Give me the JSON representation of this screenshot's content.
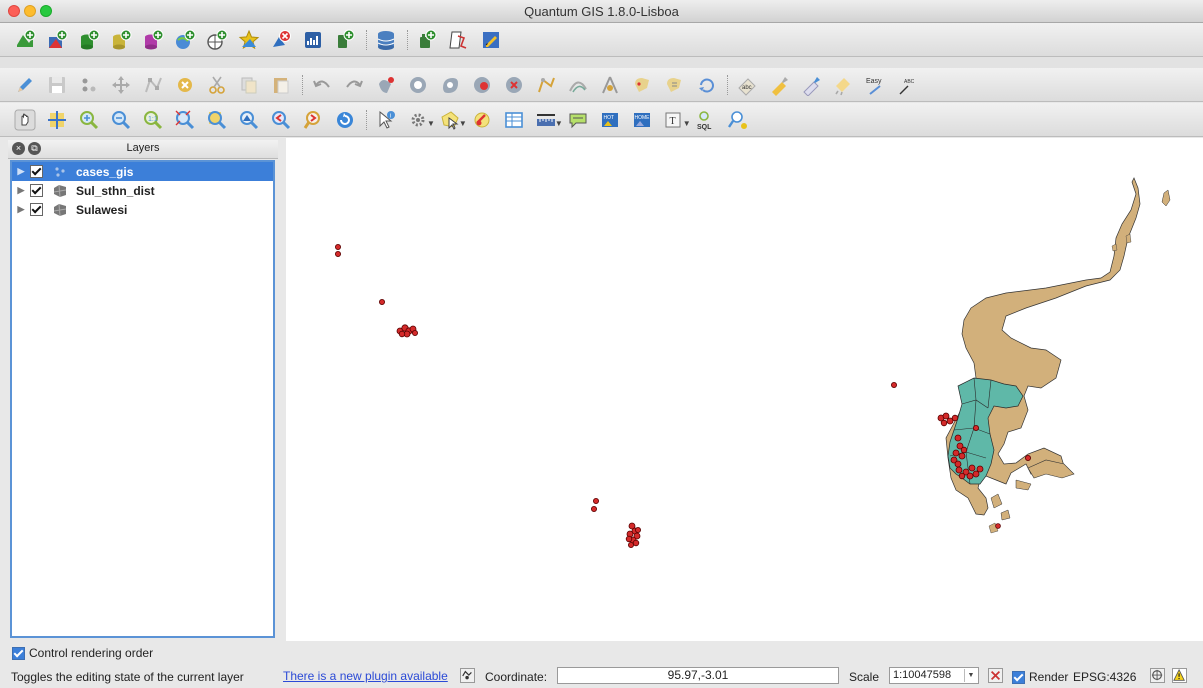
{
  "window": {
    "title": "Quantum GIS 1.8.0-Lisboa"
  },
  "toolbars": {
    "file_layers": [
      "add-vector-layer-icon",
      "add-raster-layer-icon",
      "add-postgis-layer-icon",
      "add-spatialite-layer-icon",
      "add-mssql-layer-icon",
      "add-wms-layer-icon",
      "add-wfs-layer-icon",
      "add-delimited-text-layer-icon",
      "new-shapefile-layer-icon",
      "new-spatialite-layer-icon",
      "add-gps-layer-icon",
      "db-manager-icon",
      "plugin-manager-icon",
      "python-console-icon",
      "table-manager-icon"
    ],
    "editing": [
      "toggle-editing-icon",
      "save-edits-icon",
      "add-feature-icon",
      "move-feature-icon",
      "node-tool-icon",
      "delete-selected-icon",
      "cut-features-icon",
      "copy-features-icon",
      "paste-features-icon",
      "undo-icon",
      "redo-icon",
      "simplify-feature-icon",
      "add-ring-icon",
      "add-part-icon",
      "delete-ring-icon",
      "delete-part-icon",
      "reshape-features-icon",
      "offset-curve-icon",
      "split-features-icon",
      "merge-selected-icon",
      "merge-attributes-icon",
      "rotate-point-symbols-icon",
      "label-settings-icon",
      "pin-labels-icon",
      "show-hide-labels-icon",
      "move-label-icon",
      "change-label-icon",
      "rotate-label-icon"
    ],
    "navigation": [
      "pan-map-icon",
      "pan-to-selection-icon",
      "zoom-in-icon",
      "zoom-out-icon",
      "zoom-native-icon",
      "zoom-full-icon",
      "zoom-to-selection-icon",
      "zoom-to-layer-icon",
      "zoom-last-icon",
      "zoom-next-icon",
      "refresh-icon",
      "identify-icon",
      "action-icon",
      "select-features-icon",
      "deselect-icon",
      "open-attribute-table-icon",
      "measure-line-icon",
      "map-tips-icon",
      "new-bookmark-icon",
      "show-bookmarks-icon",
      "text-annotation-icon",
      "sql-query-icon",
      "search-icon"
    ]
  },
  "layers_panel": {
    "title": "Layers",
    "items": [
      {
        "name": "cases_gis",
        "checked": true,
        "selected": true,
        "icon": "point-layer-icon"
      },
      {
        "name": "Sul_sthn_dist",
        "checked": true,
        "selected": false,
        "icon": "polygon-layer-icon"
      },
      {
        "name": "Sulawesi",
        "checked": true,
        "selected": false,
        "icon": "polygon-layer-icon"
      }
    ],
    "control_rendering_order": {
      "label": "Control rendering order",
      "checked": true
    }
  },
  "map": {
    "colors": {
      "land": "#d2b07b",
      "districts": "#5fb8a8",
      "points": "#d42a2a",
      "background": "#ffffff"
    }
  },
  "statusbar": {
    "message": "Toggles the editing state of the current layer",
    "plugin_link": "There is a new plugin available",
    "coordinate_label": "Coordinate:",
    "coordinate_value": "95.97,-3.01",
    "scale_label": "Scale",
    "scale_value": "1:10047598",
    "render_label": "Render",
    "render_checked": true,
    "crs": "EPSG:4326"
  }
}
